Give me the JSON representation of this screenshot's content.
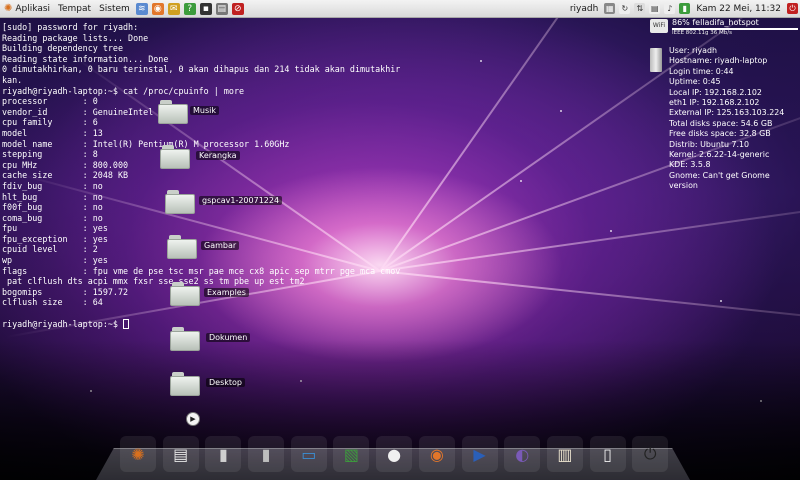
{
  "top_panel": {
    "menus": [
      {
        "label": "Aplikasi",
        "icon": "ubuntu-logo-icon"
      },
      {
        "label": "Tempat",
        "icon": ""
      },
      {
        "label": "Sistem",
        "icon": ""
      }
    ],
    "user": "riyadh",
    "clock": "Kam 22 Mei, 11:32"
  },
  "terminal": {
    "lines": [
      "[sudo] password for riyadh:",
      "Reading package lists... Done",
      "Building dependency tree",
      "Reading state information... Done",
      "0 dimutakhirkan, 0 baru terinstal, 0 akan dihapus dan 214 tidak akan dimutakhir",
      "kan.",
      "riyadh@riyadh-laptop:~$ cat /proc/cpuinfo | more",
      "processor       : 0",
      "vendor_id       : GenuineIntel",
      "cpu family      : 6",
      "model           : 13",
      "model name      : Intel(R) Pentium(R) M processor 1.60GHz",
      "stepping        : 8",
      "cpu MHz         : 800.000",
      "cache size      : 2048 KB",
      "fdiv_bug        : no",
      "hlt_bug         : no",
      "f00f_bug        : no",
      "coma_bug        : no",
      "fpu             : yes",
      "fpu_exception   : yes",
      "cpuid level     : 2",
      "wp              : yes",
      "flags           : fpu vme de pse tsc msr pae mce cx8 apic sep mtrr pge mca cmov",
      " pat clflush dts acpi mmx fxsr sse sse2 ss tm pbe up est tm2",
      "bogomips        : 1597.72",
      "clflush size    : 64",
      "",
      "riyadh@riyadh-laptop:~$ "
    ]
  },
  "desktop_icons": [
    {
      "label": "Musik"
    },
    {
      "label": "Kerangka"
    },
    {
      "label": "gspcav1-20071224"
    },
    {
      "label": "Gambar"
    },
    {
      "label": "Examples"
    },
    {
      "label": "Dokumen"
    },
    {
      "label": "Desktop"
    }
  ],
  "conky": {
    "wifi_signal": "86%",
    "wifi_ssid": "felladifa_hotspot",
    "wifi_detail": "IEEE 802.11g   36 Mb/s",
    "system_lines": [
      "User: riyadh",
      "Hostname: riyadh-laptop",
      "Login time: 0:44",
      "Uptime: 0:45",
      "Local IP: 192.168.2.102",
      "eth1 IP: 192.168.2.102",
      "External IP: 125.163.103.224",
      "Total disks space: 54.6 GB",
      "Free disks space: 32.8 GB",
      "Distrib: Ubuntu 7.10",
      "Kernel: 2.6.22-14-generic",
      "KDE: 3.5.8",
      "Gnome: Can't get Gnome",
      "version"
    ]
  },
  "dock": {
    "items": [
      {
        "name": "ubuntu-menu-icon",
        "glyph": "✺",
        "color": "#d8701e"
      },
      {
        "name": "printer-icon",
        "glyph": "▤",
        "color": "#e6e6e6"
      },
      {
        "name": "drive-icon",
        "glyph": "▮",
        "color": "#cfcfcf"
      },
      {
        "name": "removable-drive-icon",
        "glyph": "▮",
        "color": "#bdbdbd"
      },
      {
        "name": "desktop-screen-icon",
        "glyph": "▭",
        "color": "#3a8fd6"
      },
      {
        "name": "image-viewer-icon",
        "glyph": "▧",
        "color": "#3c9c3c"
      },
      {
        "name": "chat-bubble-icon",
        "glyph": "●",
        "color": "#f0f0f0"
      },
      {
        "name": "firefox-icon",
        "glyph": "◉",
        "color": "#e2762a"
      },
      {
        "name": "media-player-icon",
        "glyph": "▶",
        "color": "#2a5fb8"
      },
      {
        "name": "pidgin-icon",
        "glyph": "◐",
        "color": "#7a5ab8"
      },
      {
        "name": "book-icon",
        "glyph": "▥",
        "color": "#e8e0cc"
      },
      {
        "name": "trash-icon",
        "glyph": "▯",
        "color": "#f0f0f0"
      },
      {
        "name": "power-icon",
        "glyph": "⏻",
        "color": "#222222"
      }
    ]
  },
  "colors": {
    "panel_bg": "#e6e6e6",
    "terminal_text": "#ffffff",
    "wallpaper_accent": "#c04fc0"
  }
}
